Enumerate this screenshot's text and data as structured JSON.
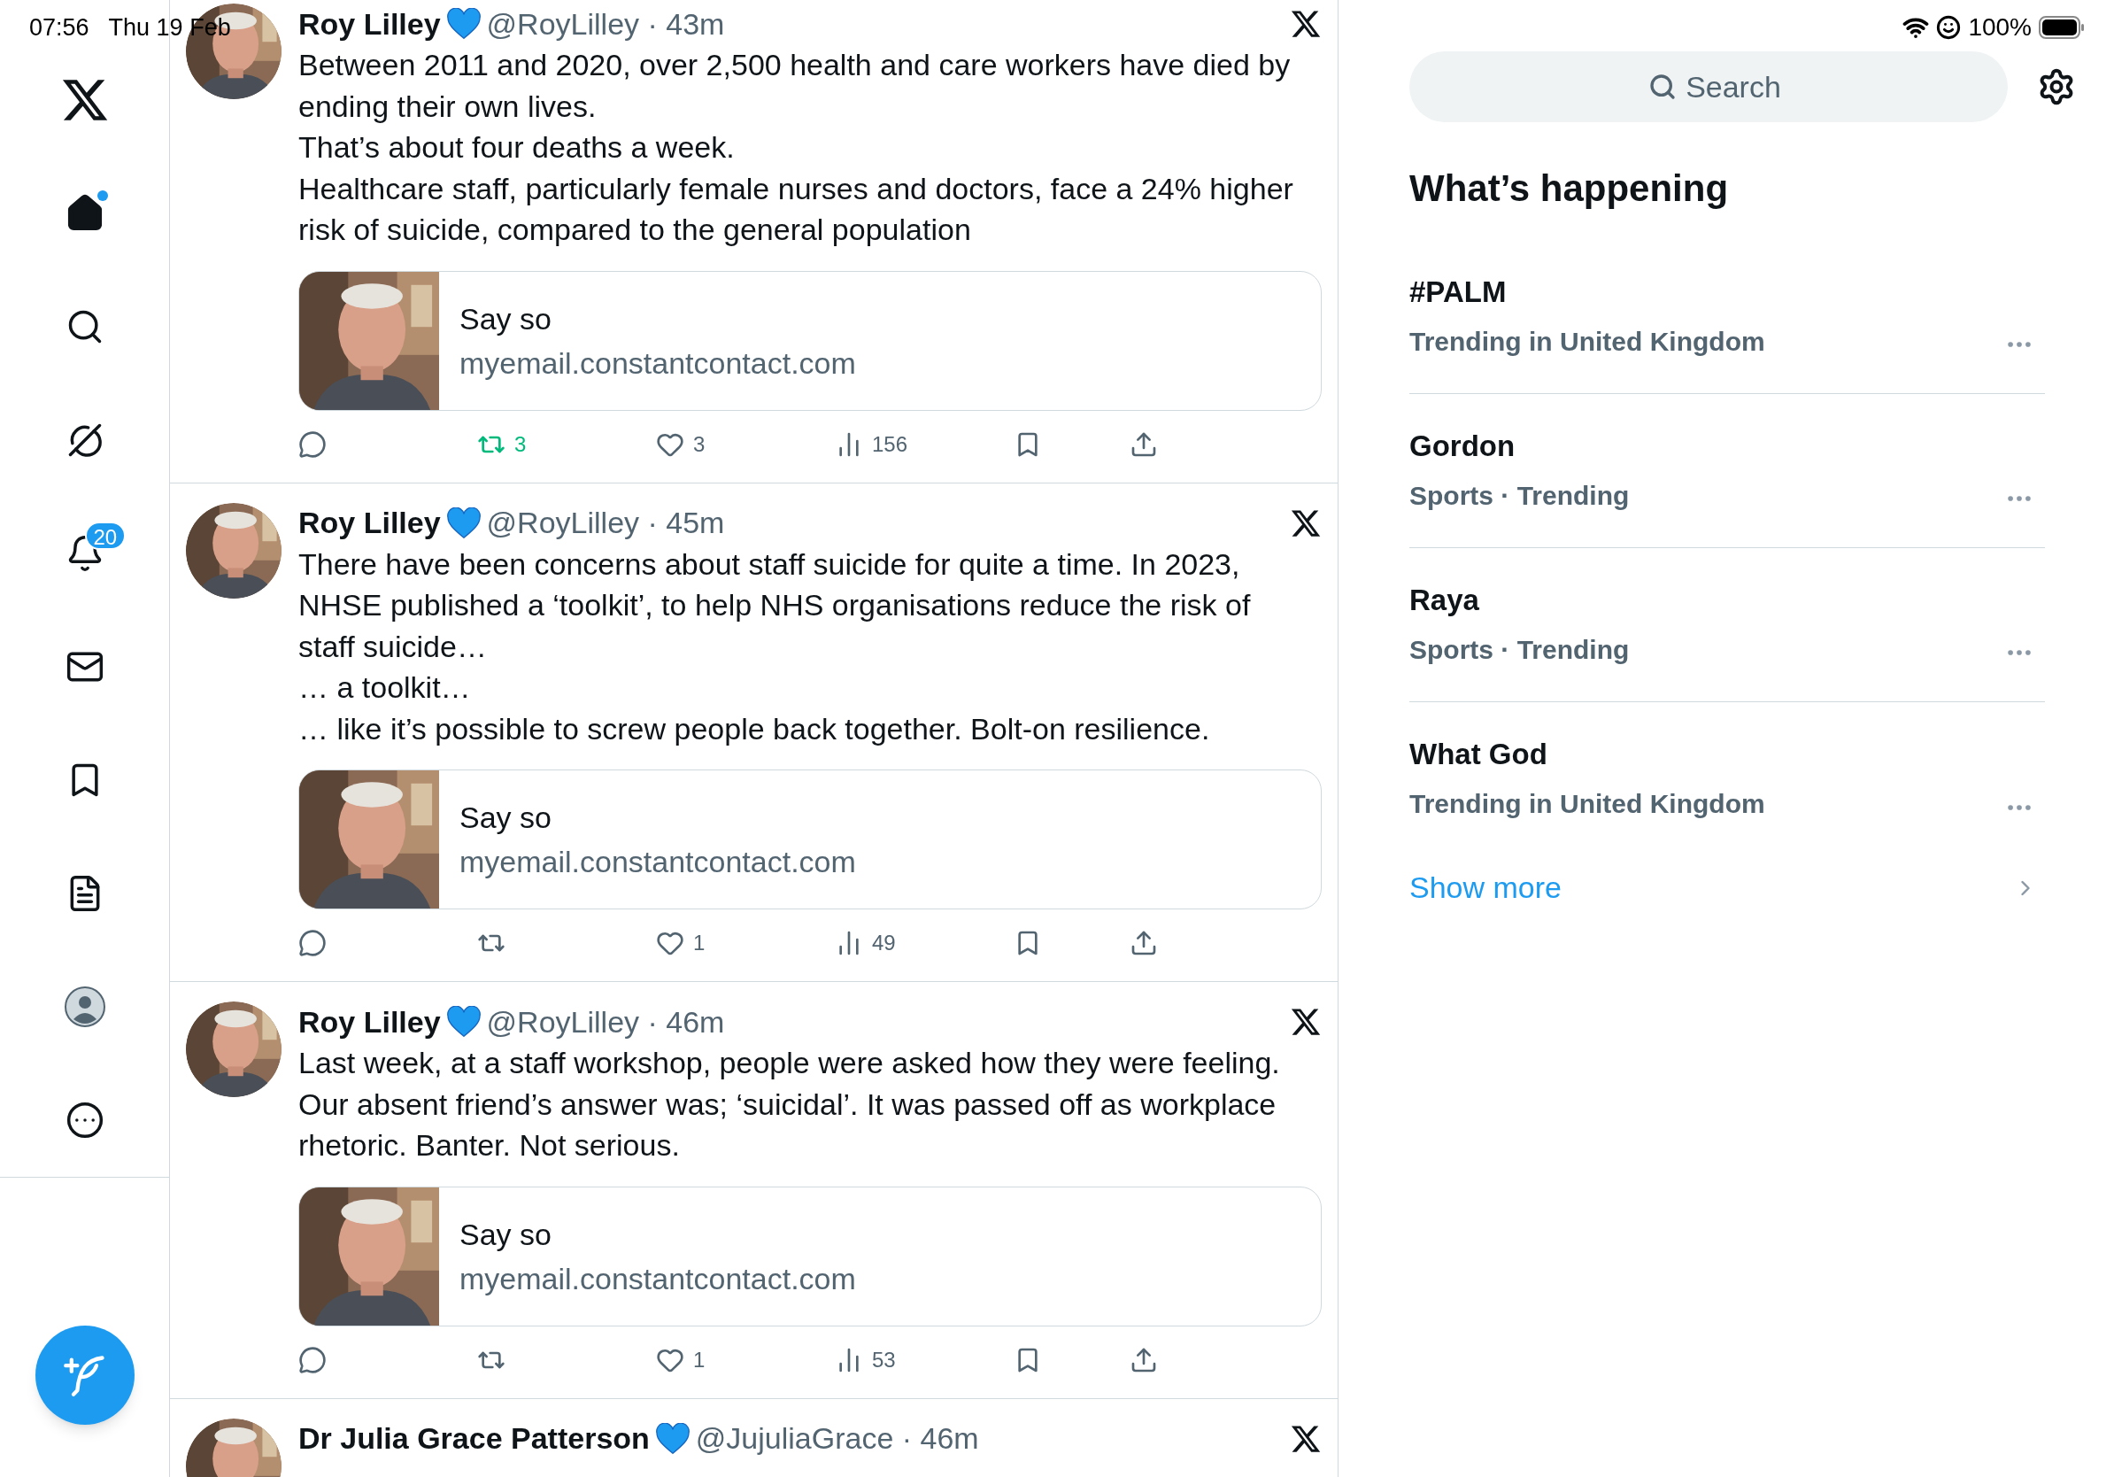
{
  "status_bar": {
    "time": "07:56",
    "date": "Thu 19 Feb",
    "battery": "100%"
  },
  "nav": [
    {
      "kind": "logo"
    },
    {
      "kind": "home",
      "selected": true,
      "dot": true
    },
    {
      "kind": "search",
      "selected": false
    },
    {
      "kind": "grok",
      "selected": false
    },
    {
      "kind": "notifications",
      "selected": false,
      "badge": "20"
    },
    {
      "kind": "messages",
      "selected": false
    },
    {
      "kind": "bookmarks",
      "selected": false
    },
    {
      "kind": "lists",
      "selected": false
    },
    {
      "kind": "profile",
      "selected": false
    },
    {
      "kind": "more",
      "selected": false
    }
  ],
  "tweets": [
    {
      "name": "Roy Lilley",
      "meta": "@RoyLilley · 43m",
      "body": [
        "Between 2011 and 2020, over 2,500 health and care workers have died by ending their own lives.",
        "That’s about four deaths a week.",
        "Healthcare staff, particularly female nurses and doctors, face a 24% higher risk of suicide, compared to the general population"
      ],
      "card": {
        "title": "Say so",
        "domain": "myemail.constantcontact.com"
      },
      "actions": [
        {
          "kind": "reply"
        },
        {
          "kind": "repost",
          "count": "3",
          "active": true
        },
        {
          "kind": "like",
          "count": "3"
        },
        {
          "kind": "views",
          "count": "156"
        },
        {
          "kind": "bookmark"
        },
        {
          "kind": "share"
        }
      ]
    },
    {
      "name": "Roy Lilley",
      "meta": "@RoyLilley · 45m",
      "body": [
        "There have been concerns about staff suicide for quite a time. In 2023, NHSE published a ‘toolkit’, to help NHS organisations reduce the risk of staff suicide…",
        "… a toolkit…",
        "… like it’s possible to screw people back together. Bolt-on resilience."
      ],
      "card": {
        "title": "Say so",
        "domain": "myemail.constantcontact.com"
      },
      "actions": [
        {
          "kind": "reply"
        },
        {
          "kind": "repost",
          "active": false
        },
        {
          "kind": "like",
          "count": "1"
        },
        {
          "kind": "views",
          "count": "49"
        },
        {
          "kind": "bookmark"
        },
        {
          "kind": "share"
        }
      ]
    },
    {
      "name": "Roy Lilley",
      "meta": "@RoyLilley · 46m",
      "body": [
        "Last week, at a staff workshop, people were asked how they were feeling.",
        "Our absent friend’s answer was; ‘suicidal’. It was passed off as workplace rhetoric. Banter. Not serious."
      ],
      "card": {
        "title": "Say so",
        "domain": "myemail.constantcontact.com"
      },
      "actions": [
        {
          "kind": "reply"
        },
        {
          "kind": "repost",
          "active": false
        },
        {
          "kind": "like",
          "count": "1"
        },
        {
          "kind": "views",
          "count": "53"
        },
        {
          "kind": "bookmark"
        },
        {
          "kind": "share"
        }
      ]
    },
    {
      "name": "Dr Julia Grace Patterson",
      "meta": "@JujuliaGrace · 46m"
    }
  ],
  "search": {
    "placeholder": "Search"
  },
  "trends_title": "What’s happening",
  "trends": [
    {
      "title": "#PALM",
      "subtitle": "Trending in United Kingdom"
    },
    {
      "title": "Gordon",
      "subtitle": "Sports · Trending"
    },
    {
      "title": "Raya",
      "subtitle": "Sports · Trending"
    },
    {
      "title": "What God",
      "subtitle": "Trending in United Kingdom"
    }
  ],
  "show_more": "Show more"
}
